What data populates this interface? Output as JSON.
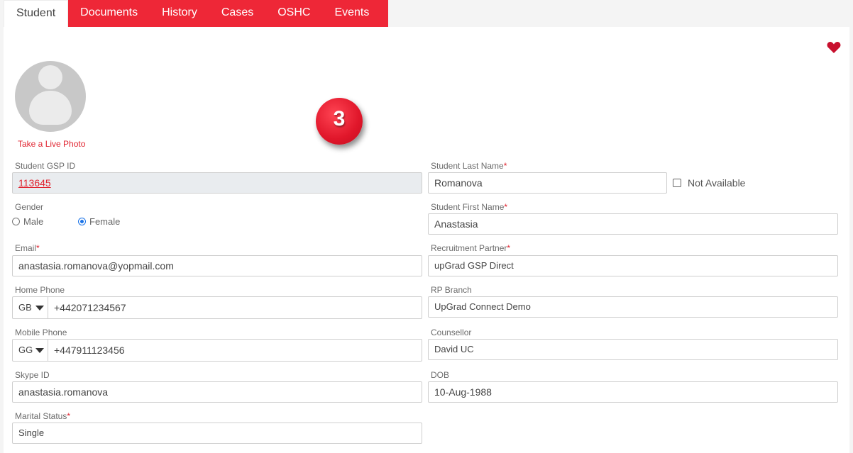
{
  "tabs": [
    {
      "label": "Student"
    },
    {
      "label": "Documents"
    },
    {
      "label": "History"
    },
    {
      "label": "Cases"
    },
    {
      "label": "OSHC"
    },
    {
      "label": "Events"
    }
  ],
  "profile": {
    "take_photo_label": "Take a Live Photo",
    "step_badge": "3"
  },
  "form": {
    "gsp_id": {
      "label": "Student GSP ID",
      "value": "113645"
    },
    "gender": {
      "label": "Gender",
      "options": [
        "Male",
        "Female"
      ],
      "selected": "Female"
    },
    "email": {
      "label": "Email",
      "required": "*",
      "value": "anastasia.romanova@yopmail.com"
    },
    "home_phone": {
      "label": "Home Phone",
      "country": "GB",
      "value": "+442071234567"
    },
    "mobile_phone": {
      "label": "Mobile Phone",
      "country": "GG",
      "value": "+447911123456"
    },
    "skype": {
      "label": "Skype ID",
      "value": "anastasia.romanova"
    },
    "marital": {
      "label": "Marital Status",
      "required": "*",
      "value": "Single"
    },
    "last_name": {
      "label": "Student Last Name",
      "required": "*",
      "value": "Romanova",
      "not_available_label": "Not Available"
    },
    "first_name": {
      "label": "Student First Name",
      "required": "*",
      "value": "Anastasia"
    },
    "partner": {
      "label": "Recruitment Partner",
      "required": "*",
      "value": "upGrad GSP Direct"
    },
    "rp_branch": {
      "label": "RP Branch",
      "value": "UpGrad Connect Demo"
    },
    "counsellor": {
      "label": "Counsellor",
      "value": "David UC"
    },
    "dob": {
      "label": "DOB",
      "value": "10-Aug-1988"
    }
  },
  "colors": {
    "accent": "#ee2737",
    "heart": "#c8102e",
    "radio_selected": "#1a73e8"
  },
  "icons": {
    "favorite": "heart-icon",
    "avatar": "user-placeholder-icon"
  }
}
